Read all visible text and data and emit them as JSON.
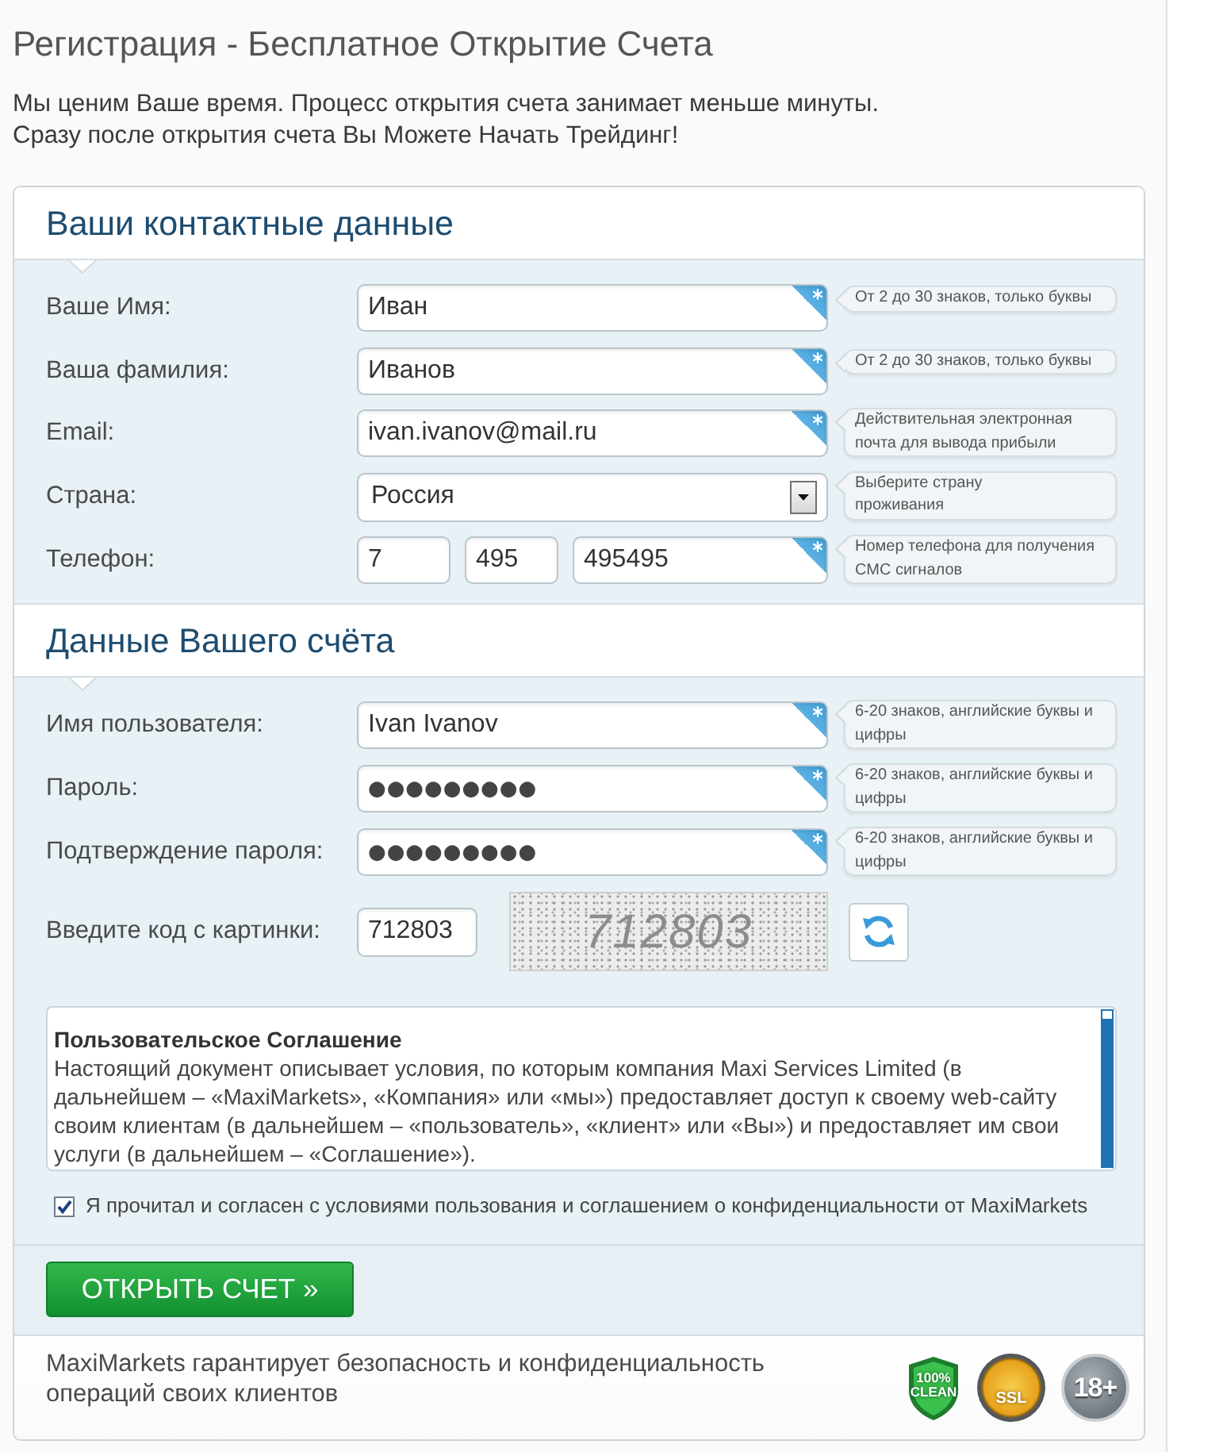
{
  "page": {
    "title": "Регистрация - Бесплатное Открытие Счета",
    "intro": [
      "Мы ценим Ваше время. Процесс открытия счета занимает меньше минуты.",
      "Сразу после открытия счета Вы Можете Начать Трейдинг!"
    ]
  },
  "sections": [
    {
      "title": "Ваши контактные данные",
      "fields": [
        {
          "kind": "text",
          "label": "Ваше Имя:",
          "value": "Иван",
          "required": true,
          "hint_lines": [
            "От 2 до 30 знаков, только буквы"
          ]
        },
        {
          "kind": "text",
          "label": "Ваша фамилия:",
          "value": "Иванов",
          "required": true,
          "hint_lines": [
            "От 2 до 30 знаков, только буквы"
          ]
        },
        {
          "kind": "text",
          "label": "Email:",
          "value": "ivan.ivanov@mail.ru",
          "required": true,
          "hint_lines": [
            "Действительная электронная",
            "почта для вывода прибыли"
          ]
        },
        {
          "kind": "select",
          "label": "Страна:",
          "value": "Россия",
          "hint_lines": [
            "Выберите страну",
            "проживания"
          ]
        },
        {
          "kind": "phone",
          "label": "Телефон:",
          "parts": [
            {
              "value": "7",
              "required": false
            },
            {
              "value": "495",
              "required": false
            },
            {
              "value": "495495",
              "required": true
            }
          ],
          "hint_lines": [
            "Номер телефона для получения",
            "СМС сигналов"
          ]
        }
      ]
    },
    {
      "title": "Данные Вашего счёта",
      "fields": [
        {
          "kind": "text",
          "label": "Имя пользователя:",
          "value": "Ivan Ivanov",
          "required": true,
          "hint_lines": [
            "6-20 знаков, английские буквы и",
            "цифры"
          ]
        },
        {
          "kind": "password",
          "label": "Пароль:",
          "value": "●●●●●●●●●",
          "required": true,
          "hint_lines": [
            "6-20 знаков, английские буквы и",
            "цифры"
          ]
        },
        {
          "kind": "password",
          "label": "Подтверждение пароля:",
          "value": "●●●●●●●●●",
          "required": true,
          "hint_lines": [
            "6-20 знаков, английские буквы и",
            "цифры"
          ]
        },
        {
          "kind": "captcha",
          "label": "Введите код с картинки:",
          "value": "712803",
          "image_text": "712803"
        }
      ]
    }
  ],
  "agreement": {
    "title": "Пользовательское Соглашение",
    "text": "Настоящий документ описывает условия, по которым компания Maxi Services Limited (в дальнейшем – «MaxiMarkets», «Компания» или «мы») предоставляет доступ к своему web-сайту своим клиентам (в дальнейшем – «пользователь», «клиент» или «Вы») и предоставляет им свои услуги (в дальнейшем – «Соглашение»)."
  },
  "consent": {
    "label": "Я прочитал и согласен с условиями пользования и соглашением о конфиденциальности от MaxiMarkets",
    "checked": true
  },
  "submit_button": {
    "label": "ОТКРЫТЬ СЧЕТ »"
  },
  "footer": {
    "text": "MaxiMarkets гарантирует безопасность и конфиденциальность операций своих клиентов",
    "badges": [
      {
        "kind": "shield",
        "text": "100% CLEAN"
      },
      {
        "kind": "seal",
        "text": "SSL"
      },
      {
        "kind": "disc",
        "text": "18+"
      }
    ]
  }
}
